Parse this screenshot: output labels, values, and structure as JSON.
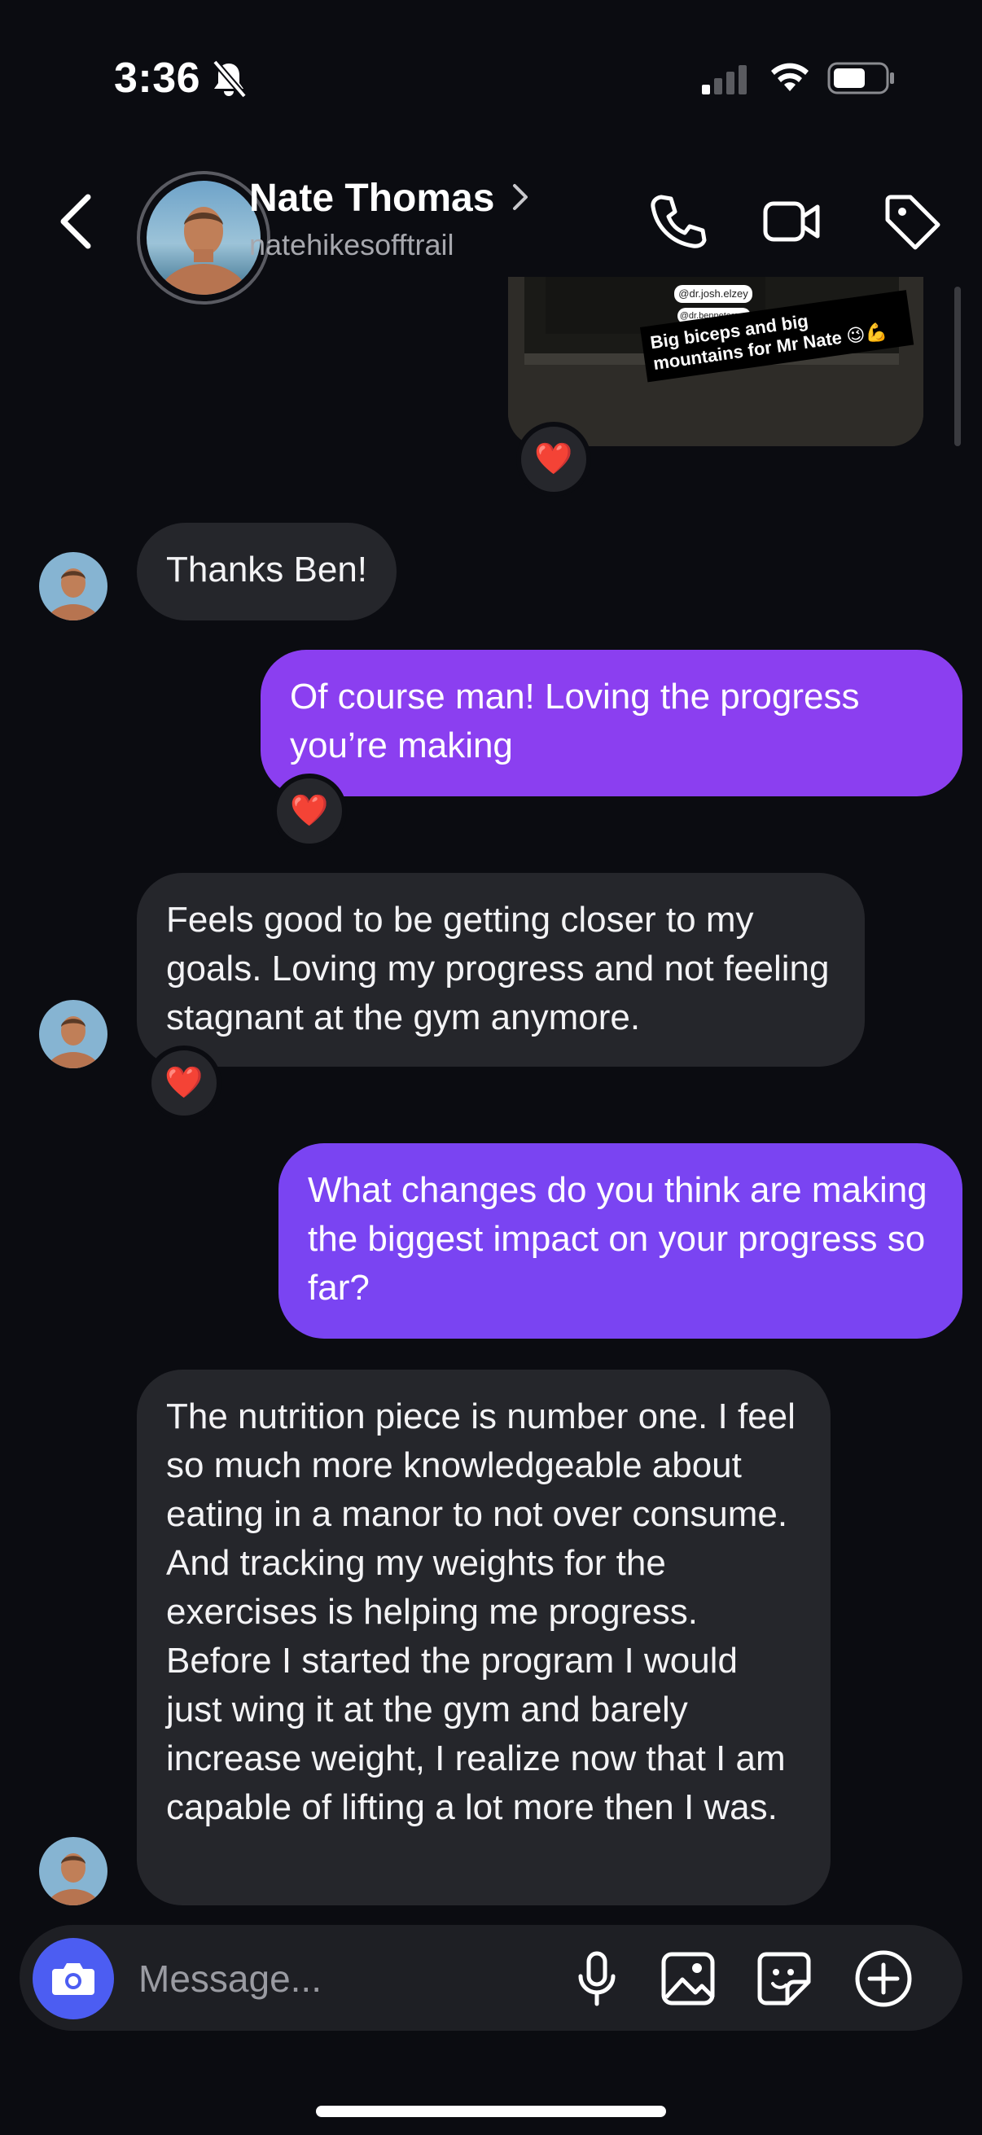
{
  "status_bar": {
    "time": "3:36"
  },
  "header": {
    "name": "Nate Thomas",
    "username": "natehikesofftrail"
  },
  "shared_post": {
    "tag1": "@dr.josh.elzey",
    "tag2": "@dr.benpetersen",
    "caption_line1": "Big biceps and big",
    "caption_line2": "mountains for Mr Nate 😉💪",
    "reaction": "❤️"
  },
  "messages": [
    {
      "id": "m1",
      "direction": "incoming",
      "text": "Thanks Ben!"
    },
    {
      "id": "m2",
      "direction": "outgoing",
      "text": "Of course man! Loving the progress you’re making",
      "reaction": "❤️"
    },
    {
      "id": "m3",
      "direction": "incoming",
      "text": "Feels good to be getting closer to my goals. Loving my progress and not feeling stagnant at the gym anymore.",
      "reaction": "❤️"
    },
    {
      "id": "m4",
      "direction": "outgoing",
      "text": "What changes do you think are making the biggest impact on your progress so far?"
    },
    {
      "id": "m5",
      "direction": "incoming",
      "text": "The nutrition piece is number one. I feel so much more knowledgeable about eating in a manor to not over consume. And tracking my weights for the exercises is helping me progress. Before I started the program I would just wing it at the gym and barely increase weight, I realize now that I am capable of lifting a lot more then I was."
    }
  ],
  "composer": {
    "placeholder": "Message..."
  },
  "colors": {
    "background": "#0b0c11",
    "incoming_bubble": "#25262b",
    "outgoing_bubble_1": "#8b3ff0",
    "outgoing_bubble_2": "#7a44f2",
    "camera_button": "#4c5df2"
  },
  "icons": [
    "bell-slash-icon",
    "cellular-signal-icon",
    "wifi-icon",
    "battery-icon",
    "back-chevron-icon",
    "phone-icon",
    "video-camera-icon",
    "tag-icon",
    "camera-icon",
    "microphone-icon",
    "image-icon",
    "sticker-icon",
    "plus-circle-icon"
  ]
}
